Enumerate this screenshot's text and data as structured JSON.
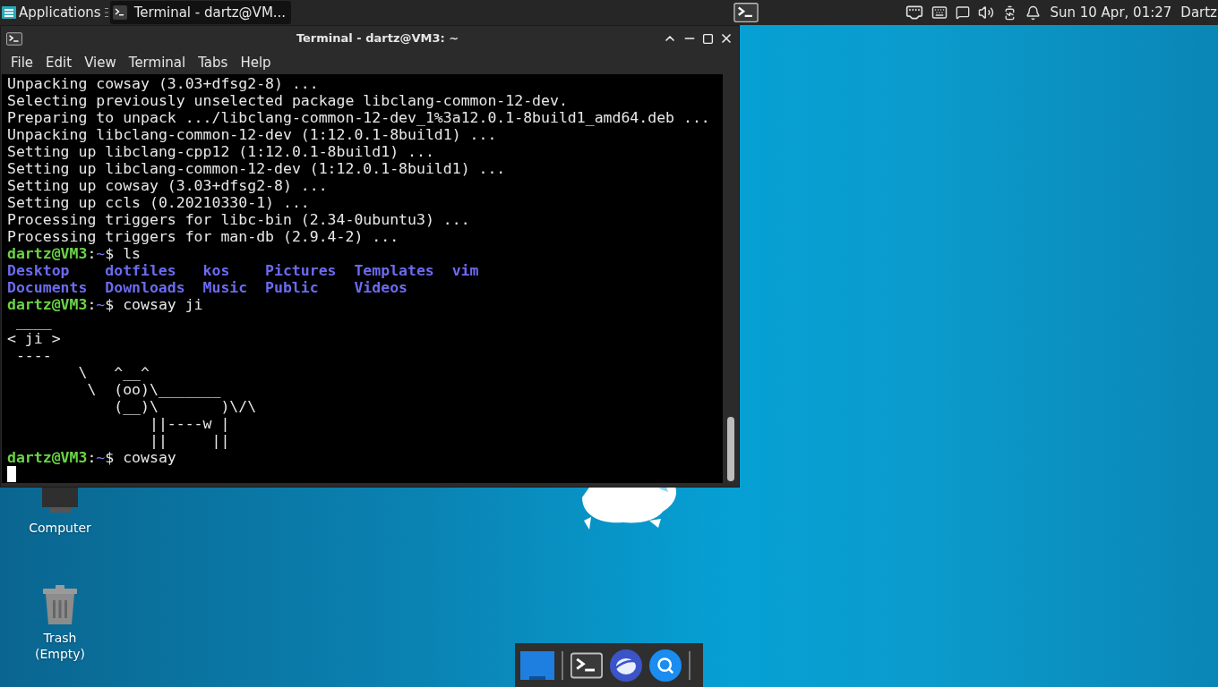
{
  "top_panel": {
    "applications_label": "Applications",
    "tasks": [
      {
        "title": "Terminal - dartz@VM...",
        "selected": true
      }
    ],
    "clock": "Sun 10 Apr, 01:27",
    "user": "Dartz"
  },
  "terminal": {
    "title": "Terminal - dartz@VM3: ~",
    "menu": [
      "File",
      "Edit",
      "View",
      "Terminal",
      "Tabs",
      "Help"
    ],
    "lines": [
      {
        "kind": "output",
        "text": "Unpacking cowsay (3.03+dfsg2-8) ..."
      },
      {
        "kind": "output",
        "text": "Selecting previously unselected package libclang-common-12-dev."
      },
      {
        "kind": "output",
        "text": "Preparing to unpack .../libclang-common-12-dev_1%3a12.0.1-8build1_amd64.deb ..."
      },
      {
        "kind": "output",
        "text": "Unpacking libclang-common-12-dev (1:12.0.1-8build1) ..."
      },
      {
        "kind": "output",
        "text": "Setting up libclang-cpp12 (1:12.0.1-8build1) ..."
      },
      {
        "kind": "output",
        "text": "Setting up libclang-common-12-dev (1:12.0.1-8build1) ..."
      },
      {
        "kind": "output",
        "text": "Setting up cowsay (3.03+dfsg2-8) ..."
      },
      {
        "kind": "output",
        "text": "Setting up ccls (0.20210330-1) ..."
      },
      {
        "kind": "output",
        "text": "Processing triggers for libc-bin (2.34-0ubuntu3) ..."
      },
      {
        "kind": "output",
        "text": "Processing triggers for man-db (2.9.4-2) ..."
      },
      {
        "kind": "prompt",
        "user": "dartz@VM3",
        "separator": ":",
        "path": "~",
        "symbol": "$",
        "command": "ls"
      },
      {
        "kind": "listing",
        "entries": [
          "Desktop",
          "dotfiles",
          "kos",
          "Pictures",
          "Templates",
          "vim"
        ]
      },
      {
        "kind": "listing",
        "entries": [
          "Documents",
          "Downloads",
          "Music",
          "Public",
          "Videos"
        ]
      },
      {
        "kind": "prompt",
        "user": "dartz@VM3",
        "separator": ":",
        "path": "~",
        "symbol": "$",
        "command": "cowsay ji"
      },
      {
        "kind": "output",
        "text": " ____"
      },
      {
        "kind": "output",
        "text": "< ji >"
      },
      {
        "kind": "output",
        "text": " ----"
      },
      {
        "kind": "output",
        "text": "        \\   ^__^"
      },
      {
        "kind": "output",
        "text": "         \\  (oo)\\_______"
      },
      {
        "kind": "output",
        "text": "            (__)\\       )\\/\\"
      },
      {
        "kind": "output",
        "text": "                ||----w |"
      },
      {
        "kind": "output",
        "text": "                ||     ||"
      },
      {
        "kind": "prompt",
        "user": "dartz@VM3",
        "separator": ":",
        "path": "~",
        "symbol": "$",
        "command": "cowsay"
      }
    ]
  },
  "desktop_icons": [
    {
      "kind": "computer",
      "label": "Computer"
    },
    {
      "kind": "trash",
      "label": "Trash (Empty)"
    }
  ]
}
